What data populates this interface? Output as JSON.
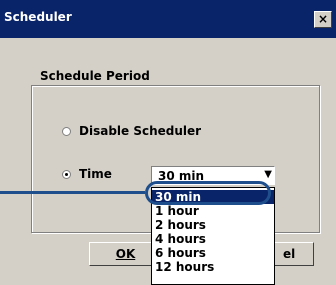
{
  "window": {
    "title": "Scheduler",
    "close_glyph": "×"
  },
  "group": {
    "label": "Schedule Period"
  },
  "options": {
    "disable": {
      "label": "Disable Scheduler",
      "checked": false
    },
    "time": {
      "label": "Time",
      "checked": true
    }
  },
  "combo": {
    "value": "30 min",
    "arrow_glyph": "▼",
    "options": [
      "30 min",
      "1 hour",
      "2 hours",
      "4 hours",
      "6 hours",
      "12 hours"
    ],
    "selected_index": 0
  },
  "buttons": {
    "ok": "OK",
    "cancel_partial": "el"
  },
  "colors": {
    "titlebar": "#0a246a",
    "selection": "#0a246a",
    "callout": "#1e4f8c"
  }
}
